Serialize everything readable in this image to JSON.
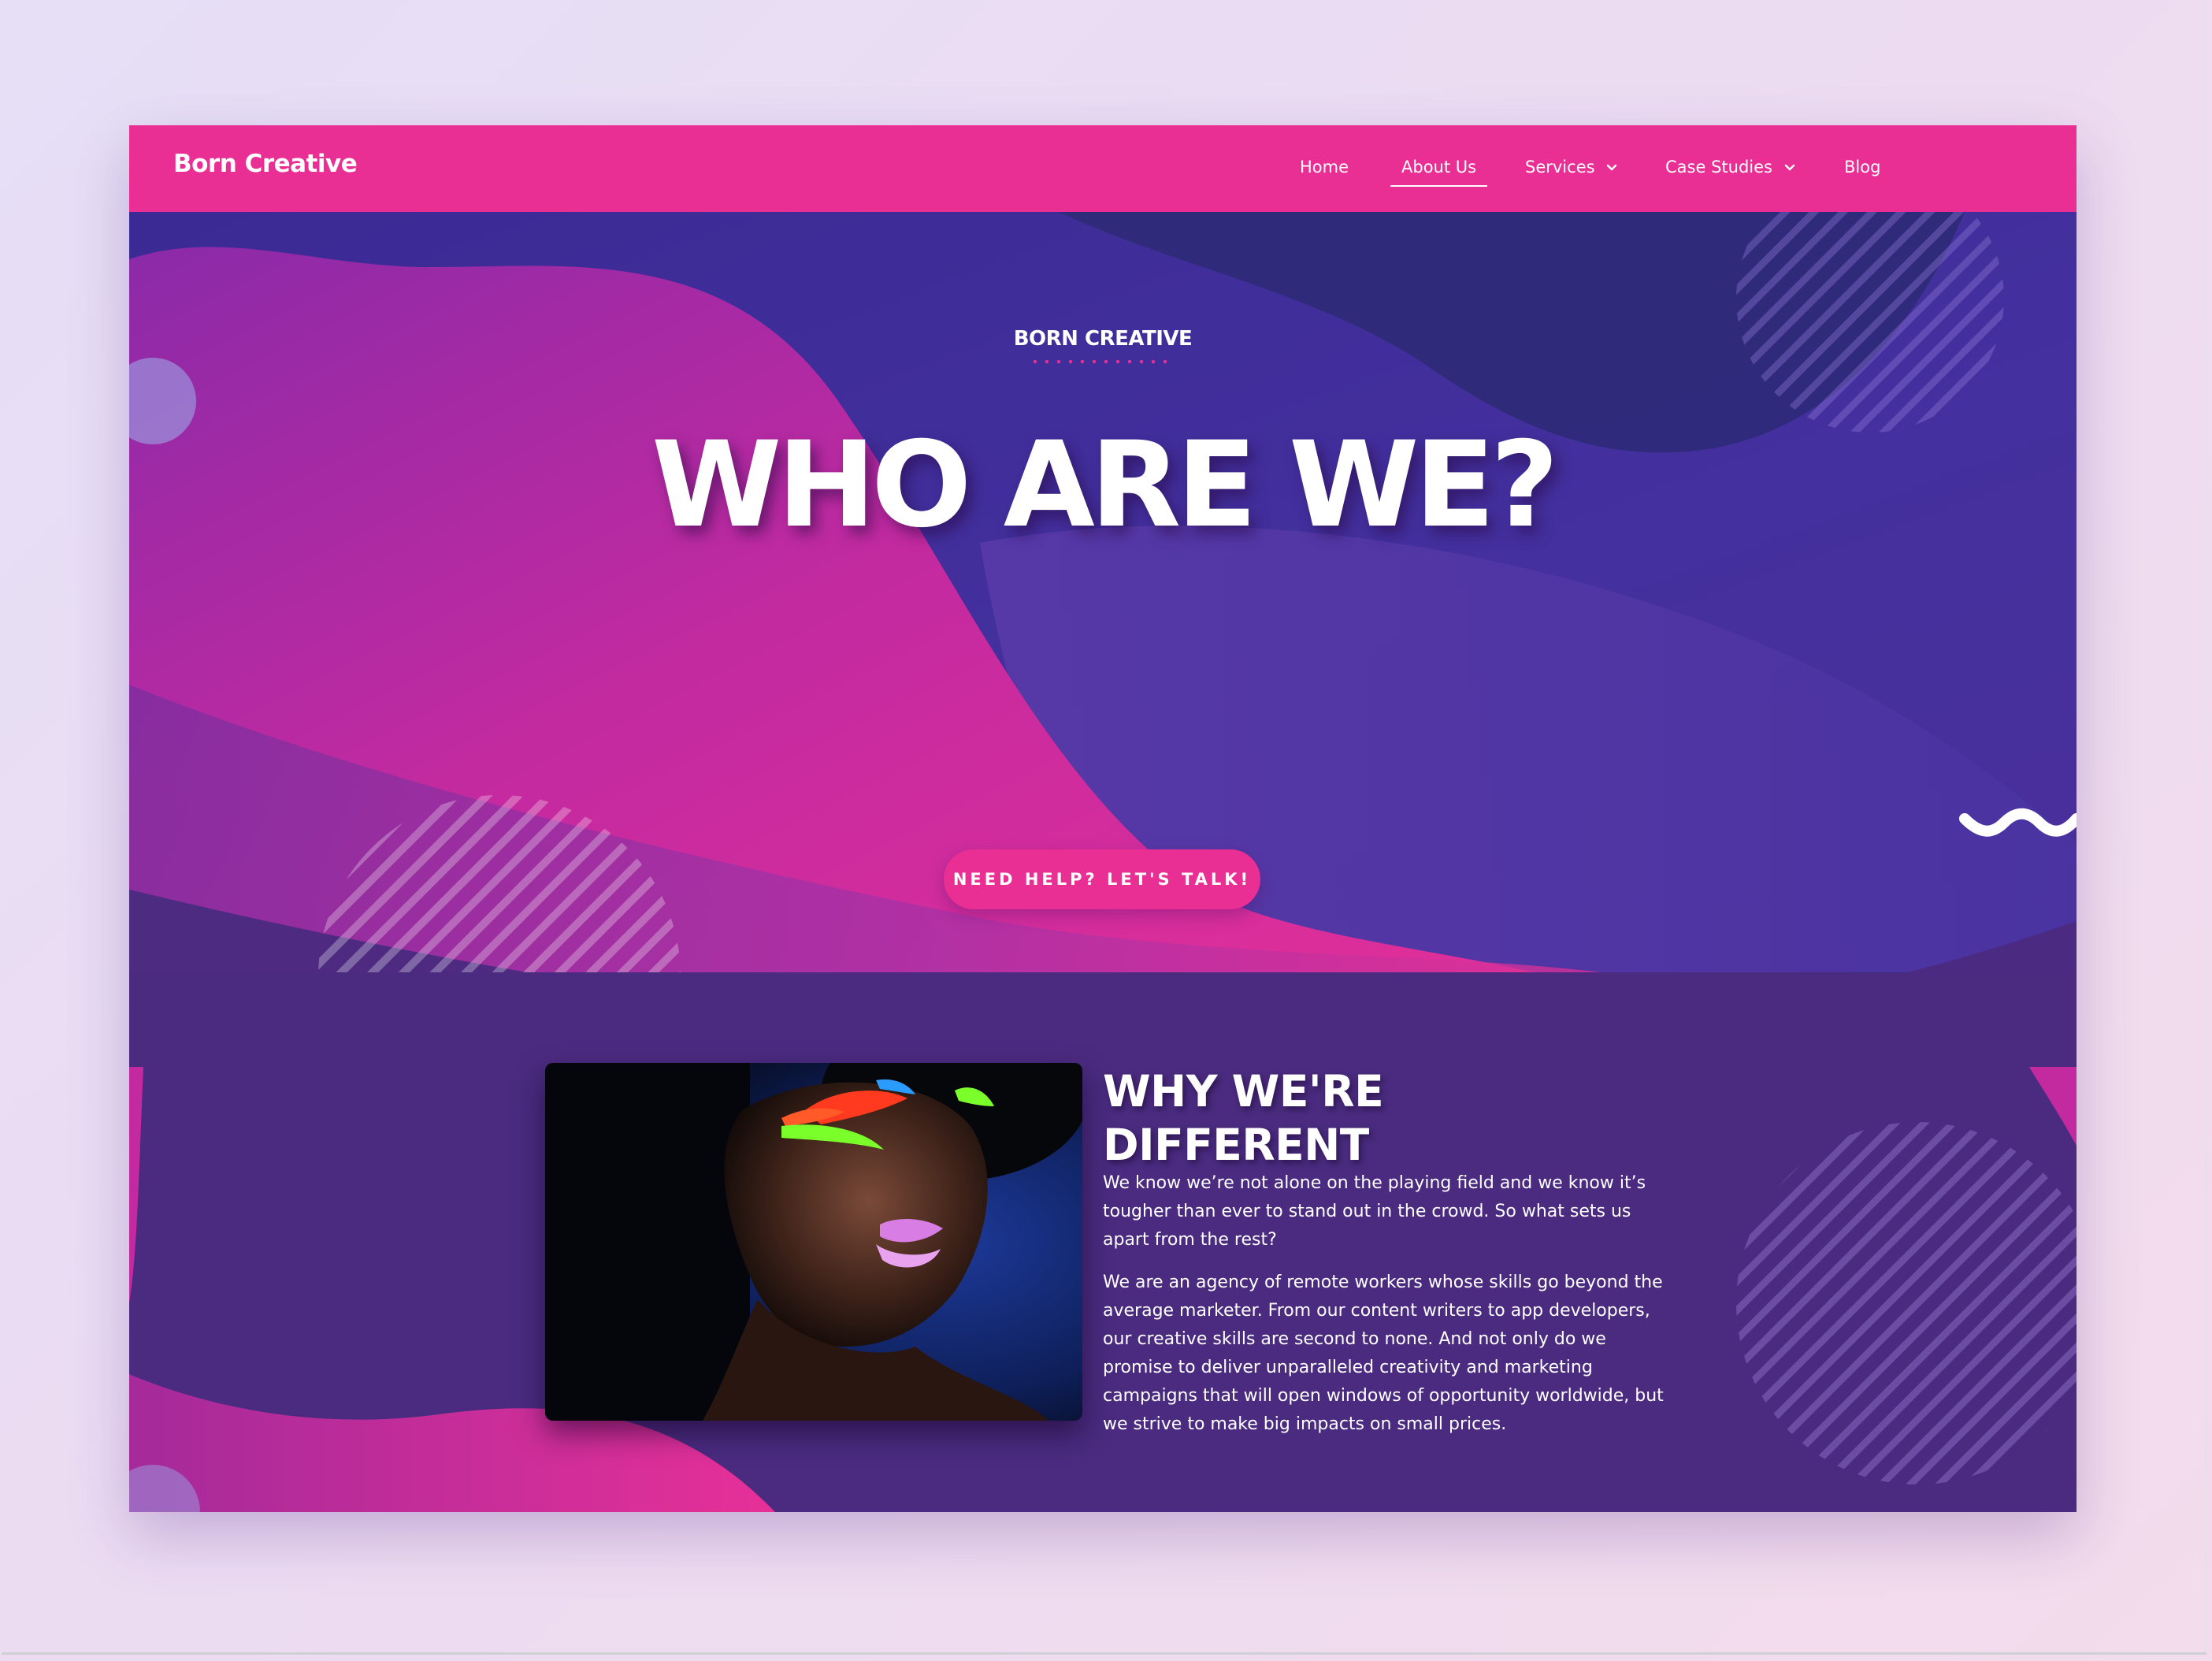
{
  "nav": {
    "logo": "Born Creative",
    "items": [
      {
        "label": "Home",
        "active": false,
        "dropdown": false
      },
      {
        "label": "About Us",
        "active": true,
        "dropdown": false
      },
      {
        "label": "Services",
        "active": false,
        "dropdown": true
      },
      {
        "label": "Case Studies",
        "active": false,
        "dropdown": true
      },
      {
        "label": "Blog",
        "active": false,
        "dropdown": false
      }
    ]
  },
  "hero": {
    "eyebrow": "BORN CREATIVE",
    "title": "WHO ARE WE?",
    "cta_label": "NEED HELP? LET'S TALK!"
  },
  "about": {
    "title_line1": "WHY WE'RE",
    "title_line2": "DIFFERENT",
    "paragraph1": "We know we’re not alone on the playing field and we know it’s tougher than ever to stand out in the crowd. So what sets us apart from the rest?",
    "paragraph2": "We are an agency of remote workers whose skills go beyond the average marketer. From our content writers to app developers, our creative skills are second to none. And not only do we promise to deliver unparalleled creativity and marketing campaigns that will open windows of opportunity worldwide, but we strive to make big impacts on small prices.",
    "image_icon": "portrait-photo"
  },
  "colors": {
    "brand_pink": "#ea2f94",
    "deep_purple": "#3c2a86",
    "section_purple": "#4a2b7f",
    "text_white": "#ffffff"
  }
}
